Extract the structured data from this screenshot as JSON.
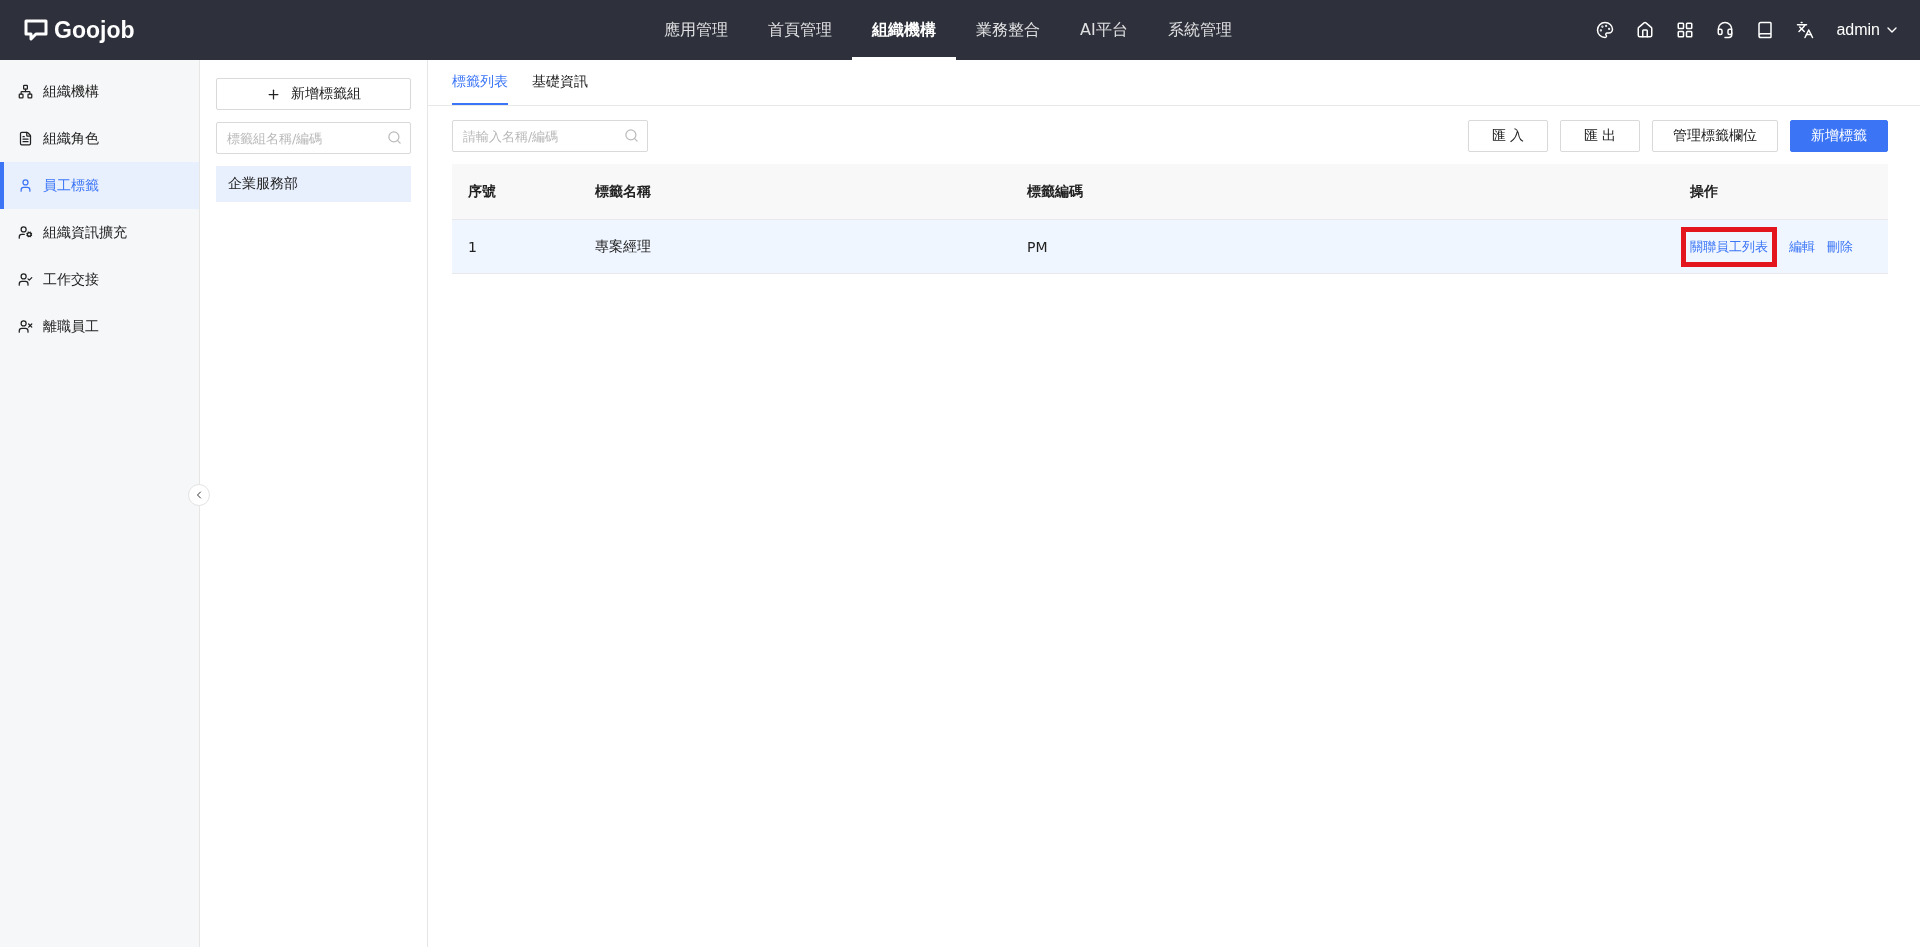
{
  "header": {
    "logo": "Goojob",
    "nav": [
      {
        "label": "應用管理",
        "selected": false
      },
      {
        "label": "首頁管理",
        "selected": false
      },
      {
        "label": "組織機構",
        "selected": true
      },
      {
        "label": "業務整合",
        "selected": false
      },
      {
        "label": "AI平台",
        "selected": false
      },
      {
        "label": "系統管理",
        "selected": false
      }
    ],
    "user": "admin"
  },
  "sidebar": {
    "items": [
      {
        "label": "組織機構",
        "selected": false
      },
      {
        "label": "組織角色",
        "selected": false
      },
      {
        "label": "員工標籤",
        "selected": true
      },
      {
        "label": "組織資訊擴充",
        "selected": false
      },
      {
        "label": "工作交接",
        "selected": false
      },
      {
        "label": "離職員工",
        "selected": false
      }
    ]
  },
  "groups": {
    "add_button": "新增標籤組",
    "search": {
      "placeholder": "標籤組名稱/編碼"
    },
    "items": [
      {
        "label": "企業服務部",
        "selected": true
      }
    ]
  },
  "tabs": [
    {
      "label": "標籤列表",
      "selected": true
    },
    {
      "label": "基礎資訊",
      "selected": false
    }
  ],
  "toolbar": {
    "search": {
      "placeholder": "請輸入名稱/編碼"
    },
    "buttons": [
      {
        "label": "匯 入",
        "primary": false
      },
      {
        "label": "匯 出",
        "primary": false
      },
      {
        "label": "管理標籤欄位",
        "primary": false
      },
      {
        "label": "新增標籤",
        "primary": true
      }
    ]
  },
  "table": {
    "columns": [
      "序號",
      "標籤名稱",
      "標籤編碼",
      "操作"
    ],
    "rows": [
      {
        "cells": [
          "1",
          "專案經理",
          "PM"
        ],
        "actions": [
          {
            "label": "關聯員工列表",
            "highlighted": true
          },
          {
            "label": "編輯",
            "highlighted": false
          },
          {
            "label": "刪除",
            "highlighted": false
          }
        ]
      }
    ]
  }
}
